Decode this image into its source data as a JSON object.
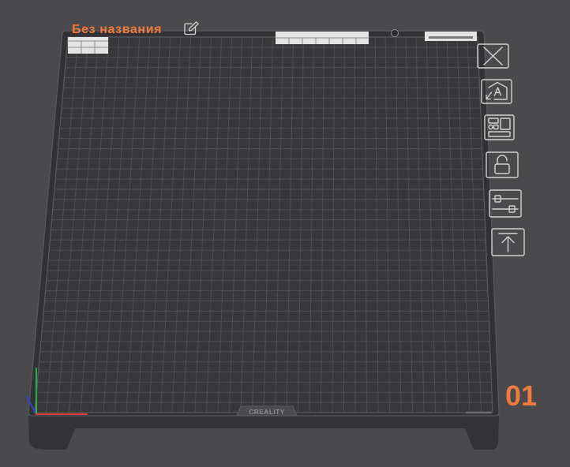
{
  "project": {
    "title": "Без названия",
    "edit_icon": "edit-icon"
  },
  "plate": {
    "index_label": "01",
    "logo_text": "CREALITY"
  },
  "plate_toolbar": [
    {
      "icon": "close-icon"
    },
    {
      "icon": "auto-orient-icon"
    },
    {
      "icon": "arrange-icon"
    },
    {
      "icon": "unlock-icon"
    },
    {
      "icon": "sliders-icon"
    },
    {
      "icon": "move-to-top-icon"
    }
  ],
  "colors": {
    "background": "#4a4a4d",
    "accent": "#ef7a3d",
    "plate_surface": "#323235",
    "grid_line": "#4f4f53",
    "toolbar_icon": "#d2d2d2",
    "axis_x": "#d93a2f",
    "axis_y": "#27b34b",
    "axis_z": "#2d45d1"
  }
}
